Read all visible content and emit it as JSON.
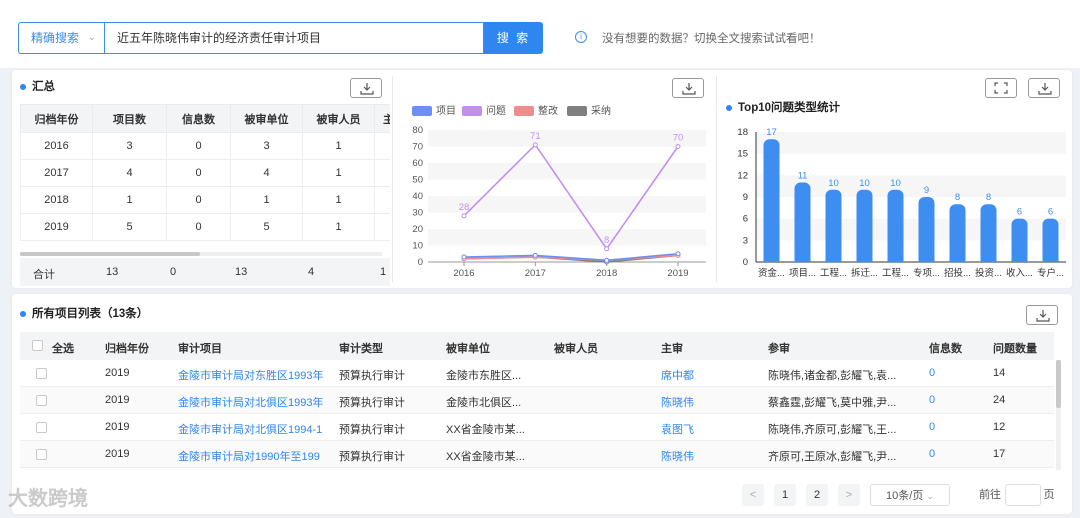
{
  "search": {
    "mode_label": "精确搜索",
    "query": "近五年陈晓伟审计的经济责任审计项目",
    "button_label": "搜 索",
    "hint": "没有想要的数据？切换全文搜索试试看吧！"
  },
  "summary": {
    "title": "汇总",
    "columns": [
      "归档年份",
      "项目数",
      "信息数",
      "被审单位",
      "被审人员",
      "主"
    ],
    "rows": [
      [
        "2016",
        "3",
        "0",
        "3",
        "1"
      ],
      [
        "2017",
        "4",
        "0",
        "4",
        "1"
      ],
      [
        "2018",
        "1",
        "0",
        "1",
        "1"
      ],
      [
        "2019",
        "5",
        "0",
        "5",
        "1"
      ]
    ],
    "total": [
      "合计",
      "13",
      "0",
      "13",
      "4",
      "1"
    ]
  },
  "line_chart_panel": {
    "chart_data": {
      "type": "line",
      "x": [
        "2016",
        "2017",
        "2018",
        "2019"
      ],
      "series": [
        {
          "name": "项目",
          "color": "#6b8ff2",
          "values": [
            3,
            4,
            1,
            5
          ]
        },
        {
          "name": "问题",
          "color": "#c28ff0",
          "values": [
            28,
            71,
            8,
            70
          ]
        },
        {
          "name": "整改",
          "color": "#f08c8c",
          "values": [
            2,
            3,
            1,
            4
          ]
        },
        {
          "name": "采纳",
          "color": "#7f7f7f",
          "values": [
            2,
            3,
            0,
            4
          ]
        }
      ],
      "ylim": [
        0,
        80
      ],
      "yticks": [
        "0",
        "10",
        "20",
        "30",
        "40",
        "50",
        "60",
        "70",
        "80"
      ],
      "labeled_series": "问题",
      "legend": "top-left"
    }
  },
  "bar_chart_panel": {
    "title": "Top10问题类型统计",
    "chart_data": {
      "type": "bar",
      "categories": [
        "资金...",
        "项目...",
        "工程...",
        "拆迁...",
        "工程...",
        "专项...",
        "招投...",
        "投资...",
        "收入...",
        "专户..."
      ],
      "values": [
        17,
        11,
        10,
        10,
        10,
        9,
        8,
        8,
        6,
        6
      ],
      "color": "#3d8ef0",
      "ylim": [
        0,
        18
      ],
      "yticks": [
        "0",
        "3",
        "6",
        "9",
        "12",
        "15",
        "18"
      ]
    }
  },
  "project_list": {
    "title": "所有项目列表（13条）",
    "columns": {
      "select_all": "全选",
      "year": "归档年份",
      "project": "审计项目",
      "type": "审计类型",
      "unit": "被审单位",
      "person": "被审人员",
      "lead": "主审",
      "members": "参审",
      "info": "信息数",
      "issues": "问题数量"
    },
    "rows": [
      {
        "year": "2019",
        "project": "金陵市审计局对东胜区1993年",
        "type": "预算执行审计",
        "unit": "金陵市东胜区...",
        "person": "",
        "lead": "席中都",
        "members": "陈晓伟,诸金都,彭耀飞,袁...",
        "info": "0",
        "issues": "14"
      },
      {
        "year": "2019",
        "project": "金陵市审计局对北俱区1993年",
        "type": "预算执行审计",
        "unit": "金陵市北俱区...",
        "person": "",
        "lead": "陈晓伟",
        "members": "蔡鑫霆,彭耀飞,莫中雅,尹...",
        "info": "0",
        "issues": "24"
      },
      {
        "year": "2019",
        "project": "金陵市审计局对北俱区1994-1",
        "type": "预算执行审计",
        "unit": "XX省金陵市某...",
        "person": "",
        "lead": "袁图飞",
        "members": "陈晓伟,齐原可,彭耀飞,王...",
        "info": "0",
        "issues": "12"
      },
      {
        "year": "2019",
        "project": "金陵市审计局对1990年至199",
        "type": "预算执行审计",
        "unit": "XX省金陵市某...",
        "person": "",
        "lead": "陈晓伟",
        "members": "齐原可,王原冰,彭耀飞,尹...",
        "info": "0",
        "issues": "17"
      }
    ]
  },
  "pagination": {
    "prev": "<",
    "pages": [
      "1",
      "2"
    ],
    "next": ">",
    "page_size": "10条/页",
    "goto_label": "前往",
    "page_unit": "页"
  },
  "watermark": "大数跨境"
}
